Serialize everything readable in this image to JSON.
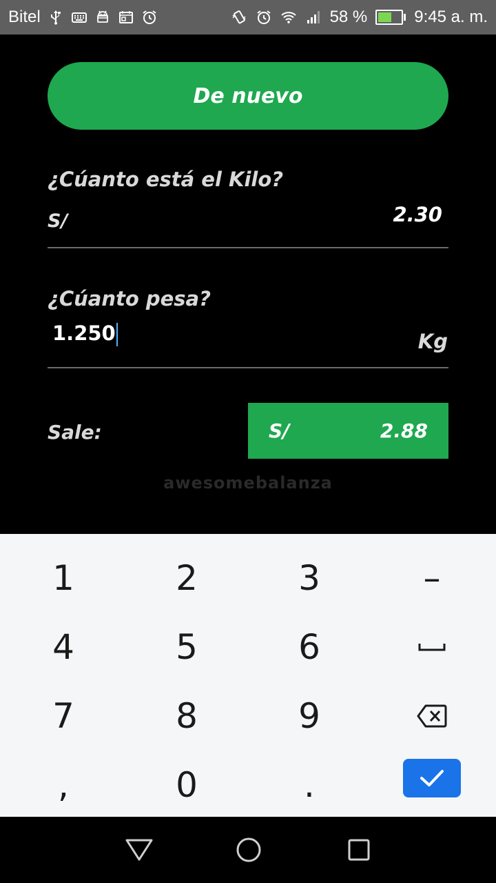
{
  "status_bar": {
    "carrier": "Bitel",
    "battery_percent": "58 %",
    "battery_level": 0.58,
    "time": "9:45 a. m.",
    "icons_left": [
      "usb-icon",
      "keyboard-icon",
      "android-icon",
      "calendar-icon",
      "alarm-icon"
    ],
    "icons_right": [
      "vibrate-icon",
      "alarm-icon",
      "wifi-icon",
      "signal-icon",
      "battery-icon"
    ]
  },
  "app": {
    "again_button": "De nuevo",
    "price_question": "¿Cúanto está el Kilo?",
    "price_prefix": "S/",
    "price_value": "2.30",
    "weight_question": "¿Cúanto pesa?",
    "weight_value": "1.250",
    "weight_unit": "Kg",
    "result_label": "Sale:",
    "result_currency": "S/",
    "result_value": "2.88",
    "brand": "awesomebalanza",
    "accent_color": "#1fa84f"
  },
  "keyboard": {
    "keys": [
      [
        "1",
        "2",
        "3",
        "–"
      ],
      [
        "4",
        "5",
        "6",
        "␣"
      ],
      [
        "7",
        "8",
        "9",
        "⌫"
      ],
      [
        ",",
        "0",
        ".",
        "✓"
      ]
    ],
    "ok_color": "#1a73e8"
  },
  "nav_bar": {
    "buttons": [
      "back-icon",
      "home-icon",
      "recents-icon"
    ]
  }
}
